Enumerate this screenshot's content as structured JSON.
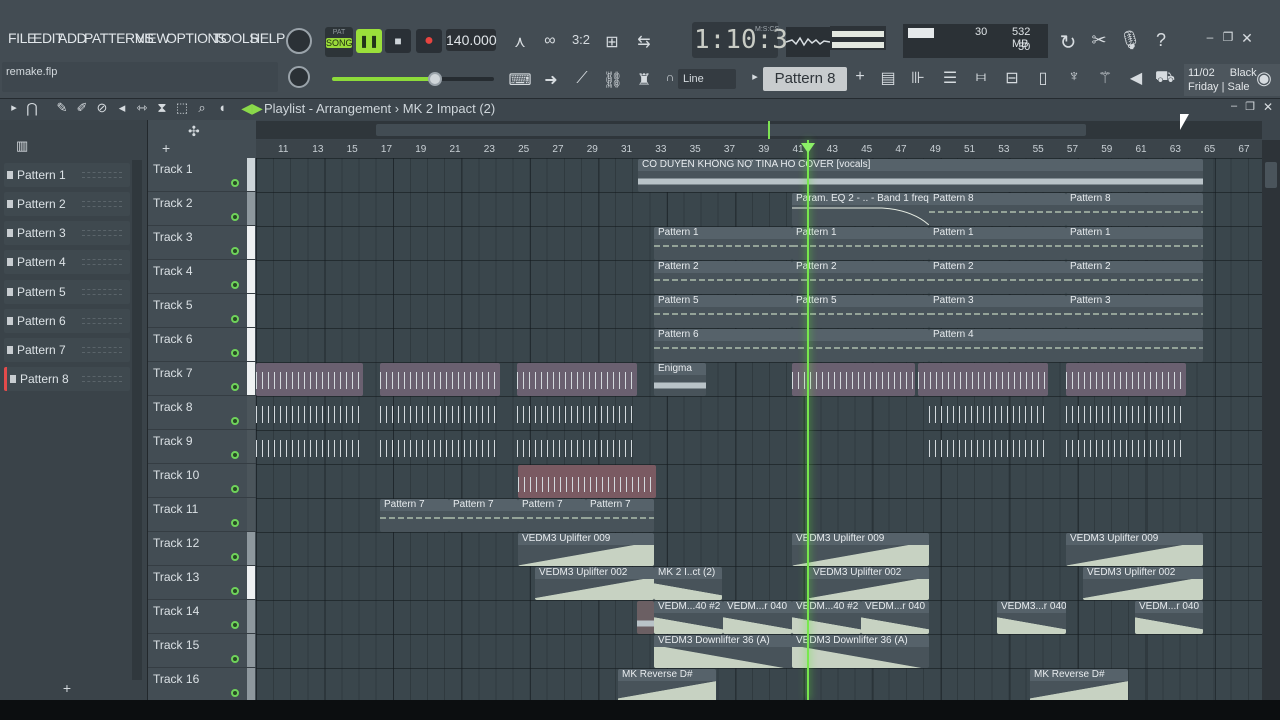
{
  "menu": [
    "FILE",
    "EDIT",
    "ADD",
    "PATTERNS",
    "VIEW",
    "OPTIONS",
    "TOOLS",
    "HELP"
  ],
  "filename": "remake.flp",
  "transport": {
    "mode_label": "SONG",
    "mode_small": "PAT",
    "bpm": "140.000",
    "time": "1:10:30",
    "time_unit": "M:S:CS"
  },
  "monitor": {
    "memory": "532 MB",
    "cpu": "30",
    "polyphony": "30"
  },
  "snap_mode": "Line",
  "pattern_selector": "Pattern 8",
  "news": {
    "date": "11/02",
    "line1": "Black",
    "line2": "Friday | Sale"
  },
  "playlist": {
    "title_prefix": "Playlist - Arrangement",
    "separator": "›",
    "title_suffix": "MK 2 Impact (2)"
  },
  "patterns": [
    "Pattern 1",
    "Pattern 2",
    "Pattern 3",
    "Pattern 4",
    "Pattern 5",
    "Pattern 6",
    "Pattern 7",
    "Pattern 8"
  ],
  "tracks": [
    "Track 1",
    "Track 2",
    "Track 3",
    "Track 4",
    "Track 5",
    "Track 6",
    "Track 7",
    "Track 8",
    "Track 9",
    "Track 10",
    "Track 11",
    "Track 12",
    "Track 13",
    "Track 14",
    "Track 15",
    "Track 16"
  ],
  "ruler": [
    "11",
    "13",
    "15",
    "17",
    "19",
    "21",
    "23",
    "25",
    "27",
    "29",
    "31",
    "33",
    "35",
    "37",
    "39",
    "41",
    "43",
    "45",
    "47",
    "49",
    "51",
    "53",
    "55",
    "57",
    "59",
    "61",
    "63",
    "65",
    "67"
  ],
  "clips": {
    "vocals": "CÓ DUYÊN KHÔNG NỢ TINA HO COVER [vocals]",
    "automation": "Param. EQ 2 - .. - Band 1 freq",
    "p1": "Pattern 1",
    "p2": "Pattern 2",
    "p3": "Pattern 3",
    "p4": "Pattern 4",
    "p5": "Pattern 5",
    "p6": "Pattern 6",
    "p7": "Pattern 7",
    "p8": "Pattern 8",
    "enigma": "Enigma",
    "uplifter009": "VEDM3 Uplifter 009",
    "uplifter002": "VEDM3 Uplifter 002",
    "mk2": "MK 2 I..ct (2)",
    "vedm40a": "VEDM...40 #2",
    "vedm40b": "VEDM...r 040",
    "vedm40c": "VEDM3...r 040",
    "downlifter": "VEDM3 Downlifter 36 (A)",
    "reverse": "MK Reverse  D#"
  },
  "add_label": "+"
}
